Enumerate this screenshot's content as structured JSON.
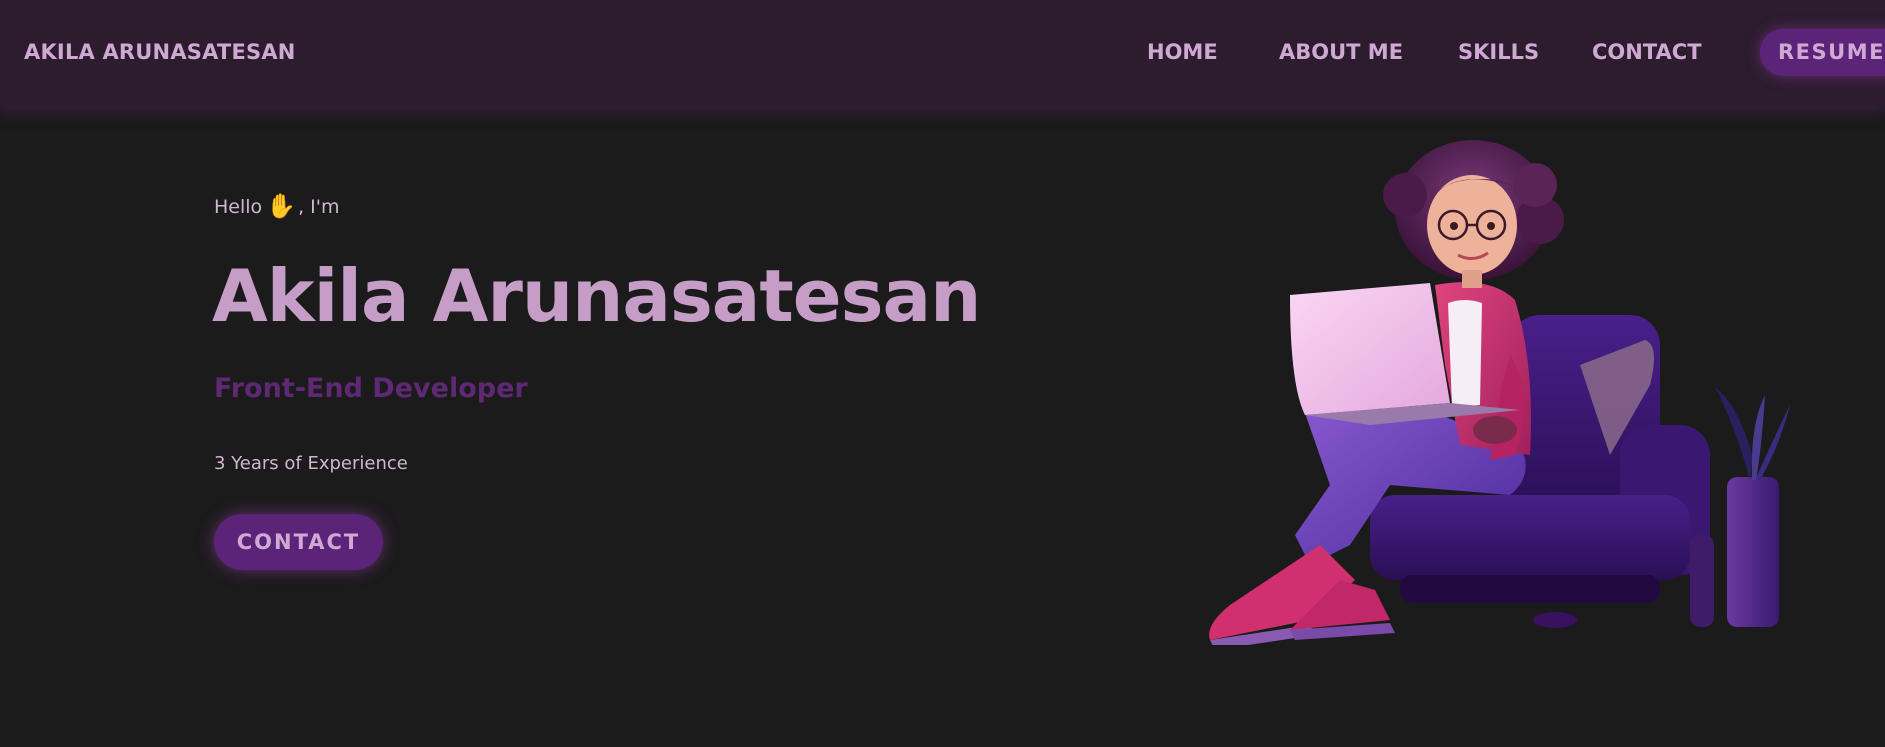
{
  "header": {
    "brand": "AKILA ARUNASATESAN",
    "nav": {
      "home": "HOME",
      "about": "ABOUT ME",
      "skills": "SKILLS",
      "contact": "CONTACT"
    },
    "resume_label": "RESUME"
  },
  "hero": {
    "greeting_prefix": "Hello",
    "wave_icon": "waving-hand-icon",
    "greeting_suffix": ", I'm",
    "name": "Akila Arunasatesan",
    "role": "Front-End Developer",
    "experience": "3 Years of Experience",
    "contact_label": "CONTACT"
  },
  "colors": {
    "background": "#1b1b1b",
    "header": "#2c1c2e",
    "accent": "#5c2479",
    "text_light": "#cfa9d3",
    "name": "#c69dc7",
    "role": "#5e2875"
  }
}
